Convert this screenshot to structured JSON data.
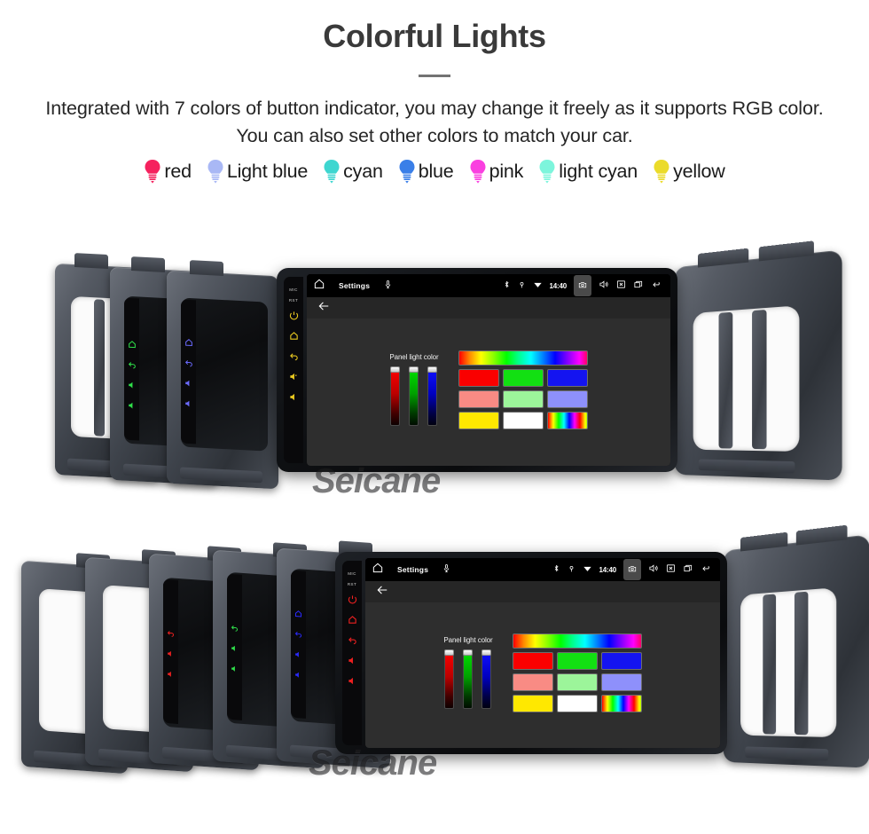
{
  "header": {
    "title": "Colorful Lights",
    "subtitle": "Integrated with 7 colors of button indicator, you may change it freely as it supports RGB color. You can also set other colors to match your car."
  },
  "legend": {
    "items": [
      {
        "label": "red",
        "color": "#f5225e",
        "icon": "bulb-icon"
      },
      {
        "label": "Light blue",
        "color": "#a9b8f5",
        "icon": "bulb-icon"
      },
      {
        "label": "cyan",
        "color": "#3ed6d0",
        "icon": "bulb-icon"
      },
      {
        "label": "blue",
        "color": "#3a7fe8",
        "icon": "bulb-icon"
      },
      {
        "label": "pink",
        "color": "#fa40e0",
        "icon": "bulb-icon"
      },
      {
        "label": "light cyan",
        "color": "#7df5dc",
        "icon": "bulb-icon"
      },
      {
        "label": "yellow",
        "color": "#ebdb2a",
        "icon": "bulb-icon"
      }
    ]
  },
  "watermark": {
    "text": "Seicane"
  },
  "head_unit": {
    "status_bar": {
      "home_icon": "home-icon",
      "title": "Settings",
      "mic_icon": "microphone-icon",
      "bluetooth_icon": "bluetooth-icon",
      "location_icon": "location-pin-icon",
      "wifi_icon": "wifi-icon",
      "clock": "14:40",
      "camera_icon": "camera-icon",
      "volume_icon": "speaker-icon",
      "close_icon": "x-box-icon",
      "recents_icon": "recent-apps-icon",
      "back_icon": "back-arrow-icon"
    },
    "app_bar": {
      "back_icon": "back-arrow-icon"
    },
    "panel": {
      "caption": "Panel light color",
      "sliders": [
        {
          "name": "red-slider",
          "channel": "R",
          "value": 100
        },
        {
          "name": "green-slider",
          "channel": "G",
          "value": 100
        },
        {
          "name": "blue-slider",
          "channel": "B",
          "value": 100
        }
      ],
      "swatch_rows": [
        [
          {
            "name": "rainbow-gradient-swatch",
            "type": "rainbow-h",
            "color": ""
          }
        ],
        [
          {
            "name": "red-swatch",
            "type": "solid",
            "color": "#fa0000"
          },
          {
            "name": "green-swatch",
            "type": "solid",
            "color": "#12e012"
          },
          {
            "name": "blue-swatch",
            "type": "solid",
            "color": "#1414f0"
          }
        ],
        [
          {
            "name": "salmon-swatch",
            "type": "solid",
            "color": "#f98b84"
          },
          {
            "name": "light-green-swatch",
            "type": "solid",
            "color": "#9cf59a"
          },
          {
            "name": "periwinkle-swatch",
            "type": "solid",
            "color": "#8e90fb"
          }
        ],
        [
          {
            "name": "yellow-swatch",
            "type": "solid",
            "color": "#ffe800"
          },
          {
            "name": "white-swatch",
            "type": "solid",
            "color": "#ffffff"
          },
          {
            "name": "rainbow-stripe-swatch",
            "type": "rainbow-v",
            "color": ""
          }
        ]
      ]
    },
    "side_buttons": {
      "labels": [
        "MIC",
        "RST"
      ],
      "glyphs": [
        {
          "name": "power-button",
          "icon": "power-icon"
        },
        {
          "name": "home-button",
          "icon": "home-icon"
        },
        {
          "name": "back-button",
          "icon": "return-arrow-icon"
        },
        {
          "name": "volume-up-button",
          "icon": "volume-up-icon"
        },
        {
          "name": "volume-down-button",
          "icon": "volume-down-icon"
        }
      ]
    }
  },
  "groups": [
    {
      "name": "top-product-group",
      "lit_color": "#e8c820",
      "stacked_units": [
        {
          "name": "fascia-panel-1",
          "lit_color": ""
        },
        {
          "name": "fascia-panel-2",
          "lit_color": "#2fe04a"
        },
        {
          "name": "fascia-panel-3",
          "lit_color": "#6a6aff"
        }
      ]
    },
    {
      "name": "bottom-product-group",
      "lit_color": "#ee2020",
      "stacked_units": [
        {
          "name": "fascia-panel-1",
          "lit_color": ""
        },
        {
          "name": "fascia-panel-2",
          "lit_color": "#ee2020"
        },
        {
          "name": "fascia-panel-3",
          "lit_color": "#2fe04a"
        },
        {
          "name": "fascia-panel-4",
          "lit_color": "#2a2aff"
        }
      ]
    }
  ]
}
